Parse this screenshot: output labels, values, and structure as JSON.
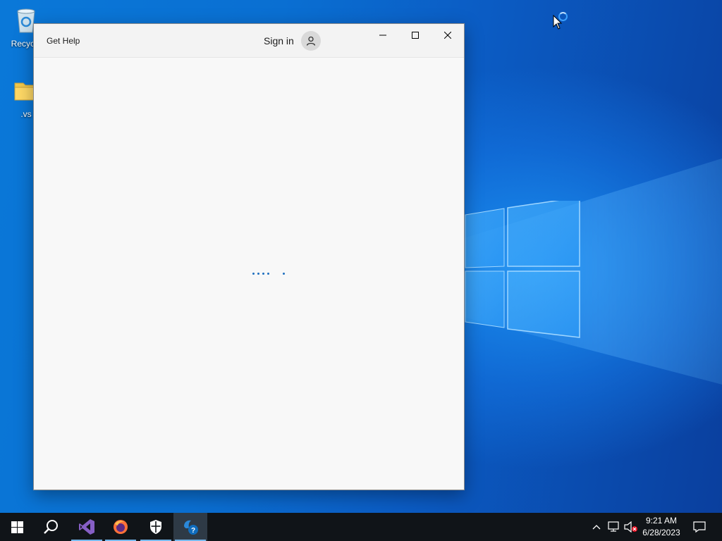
{
  "desktop": {
    "icons": [
      {
        "label": "Recycle"
      },
      {
        "label": ".vs"
      }
    ]
  },
  "window": {
    "title": "Get Help",
    "sign_in_label": "Sign in",
    "loading": true
  },
  "taskbar": {
    "items": [
      {
        "name": "start"
      },
      {
        "name": "search"
      },
      {
        "name": "visual-studio"
      },
      {
        "name": "firefox"
      },
      {
        "name": "windows-security"
      },
      {
        "name": "get-help"
      }
    ],
    "clock": {
      "time": "9:21 AM",
      "date": "6/28/2023"
    }
  },
  "colors": {
    "accent": "#0078d7",
    "taskbar": "#101418",
    "window_bg": "#f8f8f8",
    "titlebar_bg": "#f3f3f3",
    "loading_dots": "#1e6fbf"
  }
}
